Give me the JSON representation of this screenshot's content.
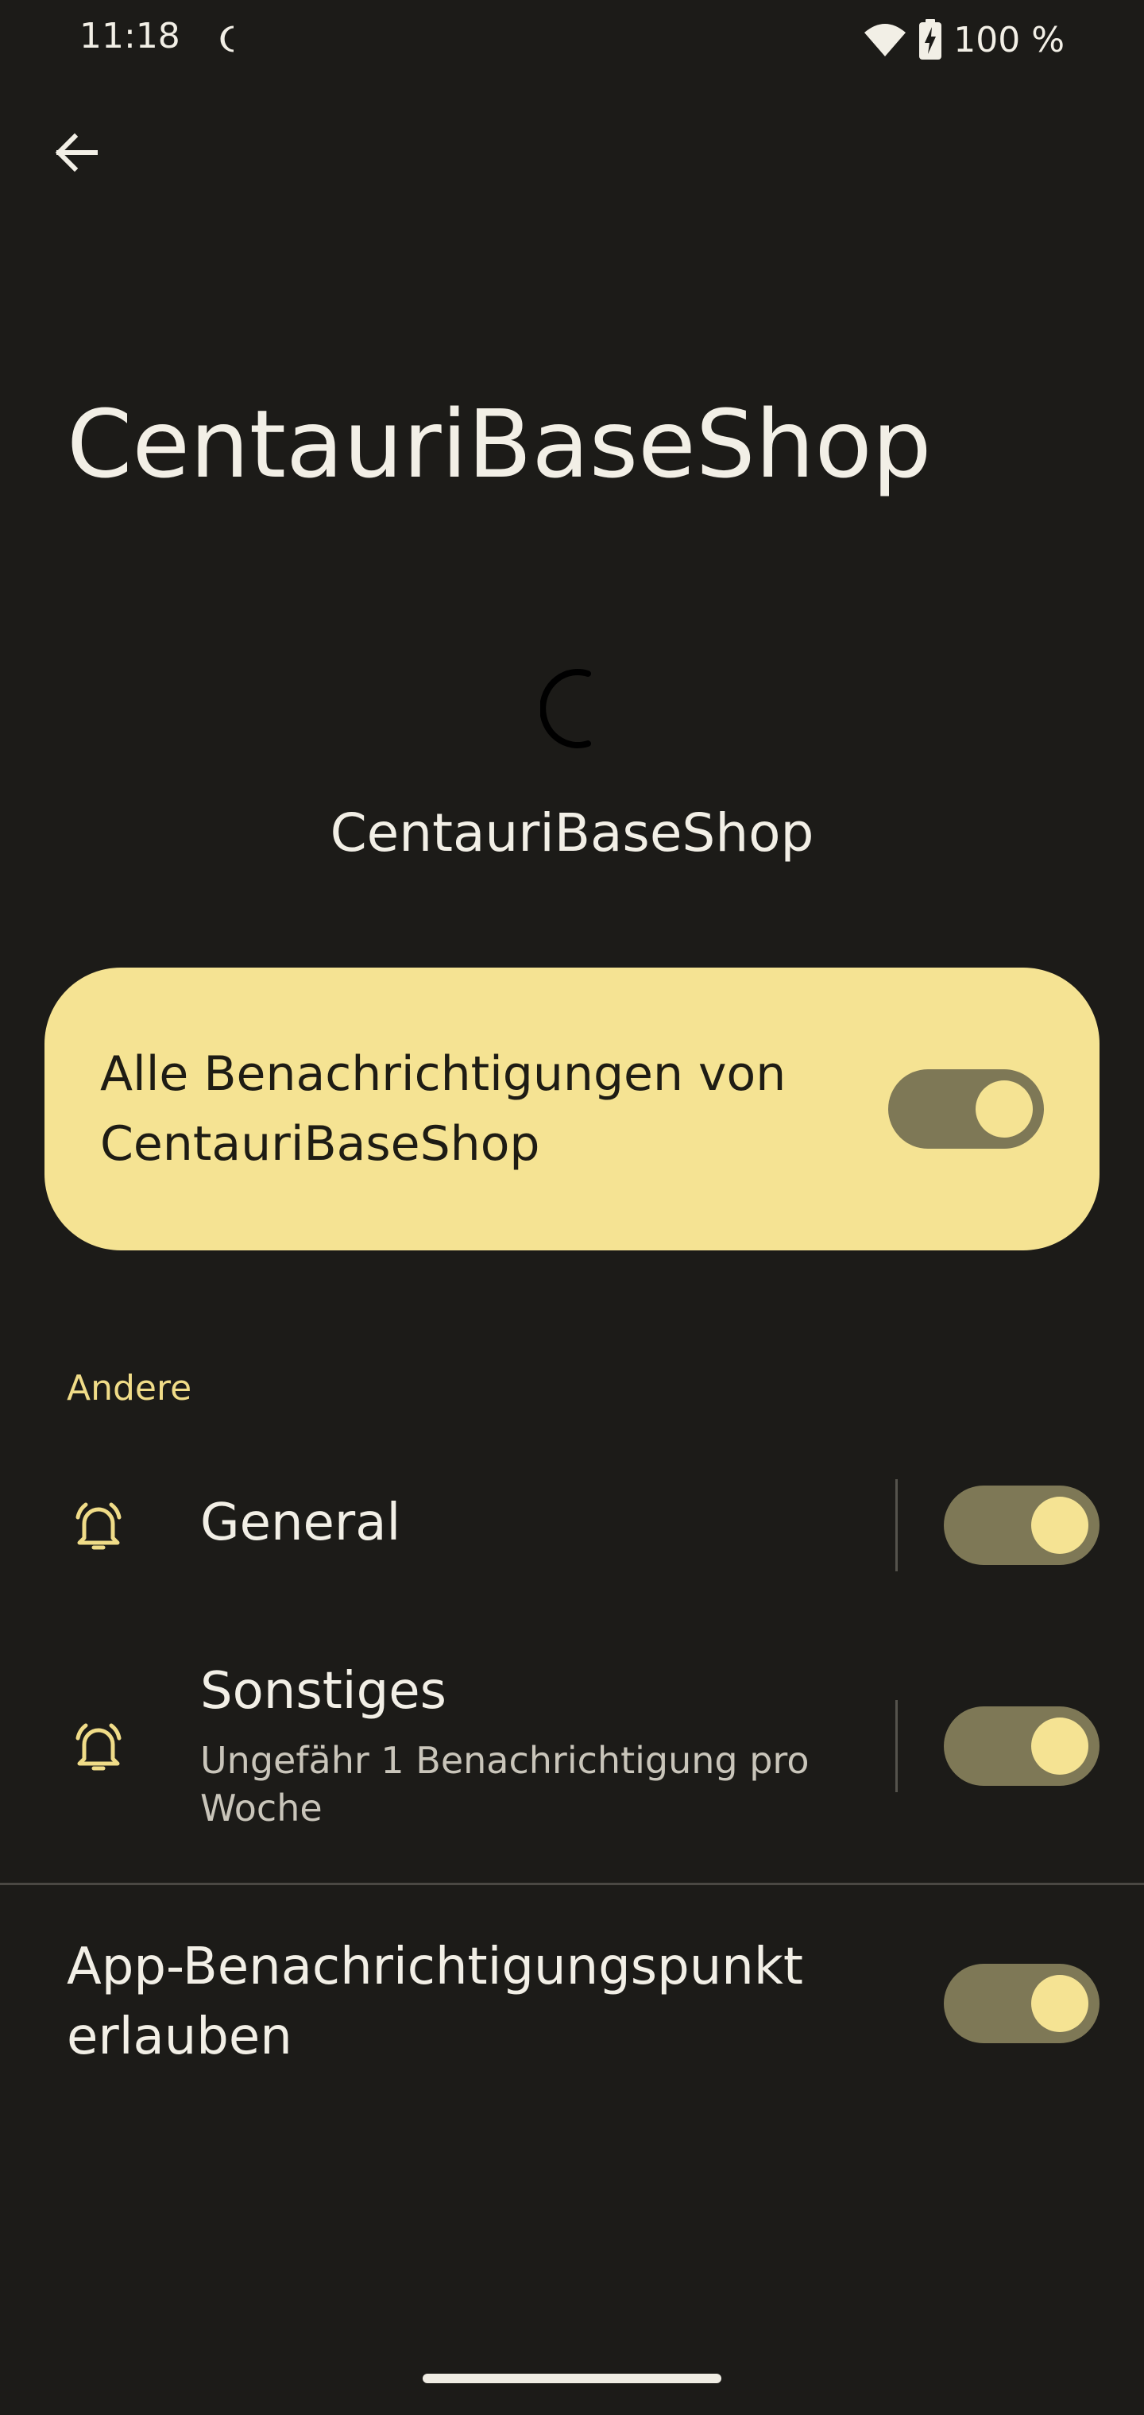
{
  "status_bar": {
    "time": "11:18",
    "battery_percent": "100 %",
    "icons": [
      "do-not-disturb-moon-icon",
      "wifi-icon",
      "battery-charging-icon"
    ]
  },
  "header": {
    "back_icon": "arrow-left-icon",
    "title": "CentauriBaseShop"
  },
  "app": {
    "name": "CentauriBaseShop",
    "icon": "loading-spinner-icon"
  },
  "master_toggle": {
    "label": "Alle Benachrichtigungen von CentauriBaseShop",
    "enabled": true
  },
  "section": {
    "header": "Andere"
  },
  "channels": [
    {
      "icon": "bell-ring-icon",
      "title": "General",
      "subtitle": "",
      "enabled": true
    },
    {
      "icon": "bell-ring-icon",
      "title": "Sonstiges",
      "subtitle": "Ungefähr 1 Benachrichtigung pro Woche",
      "enabled": true
    }
  ],
  "notification_dot": {
    "label": "App-Benachrichtigungspunkt erlauben",
    "enabled": true
  },
  "colors": {
    "background": "#1c1b18",
    "accent": "#f5e393",
    "toggle_track": "#7e7856",
    "section_header": "#f0dc88"
  }
}
